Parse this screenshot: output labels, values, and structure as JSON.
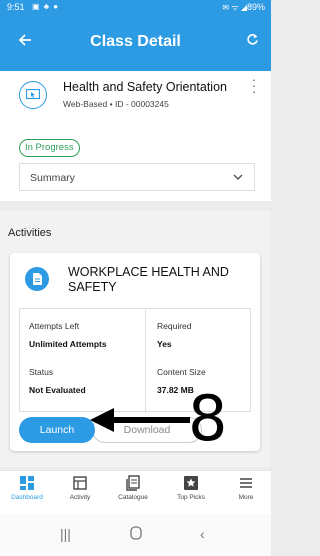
{
  "status_bar": {
    "time": "9:51",
    "battery": "89%"
  },
  "appbar": {
    "title": "Class Detail",
    "back_icon": "arrow-left-icon",
    "refresh_icon": "refresh-icon"
  },
  "course": {
    "title": "Health and Safety Orientation",
    "meta": "Web-Based • ID - 00003245",
    "status": "In Progress",
    "status_color": "#2e9e5a",
    "summary_label": "Summary"
  },
  "activities": {
    "heading": "Activities",
    "item": {
      "title": "WORKPLACE HEALTH AND SAFETY",
      "attempts_left_label": "Attempts Left",
      "attempts_left_value": "Unlimited Attempts",
      "required_label": "Required",
      "required_value": "Yes",
      "status_label": "Status",
      "status_value": "Not Evaluated",
      "content_size_label": "Content Size",
      "content_size_value": "37.82 MB",
      "launch_label": "Launch",
      "download_label": "Download"
    }
  },
  "annotation": {
    "number": "8"
  },
  "bottom_nav": [
    {
      "label": "Dashboard",
      "icon": "dashboard-icon",
      "active": true
    },
    {
      "label": "Activity",
      "icon": "activity-icon",
      "active": false
    },
    {
      "label": "Catalogue",
      "icon": "catalogue-icon",
      "active": false
    },
    {
      "label": "Top Picks",
      "icon": "top-picks-icon",
      "active": false
    },
    {
      "label": "More",
      "icon": "menu-icon",
      "active": false
    }
  ],
  "colors": {
    "primary": "#2d9be4",
    "success": "#2e9e5a"
  }
}
